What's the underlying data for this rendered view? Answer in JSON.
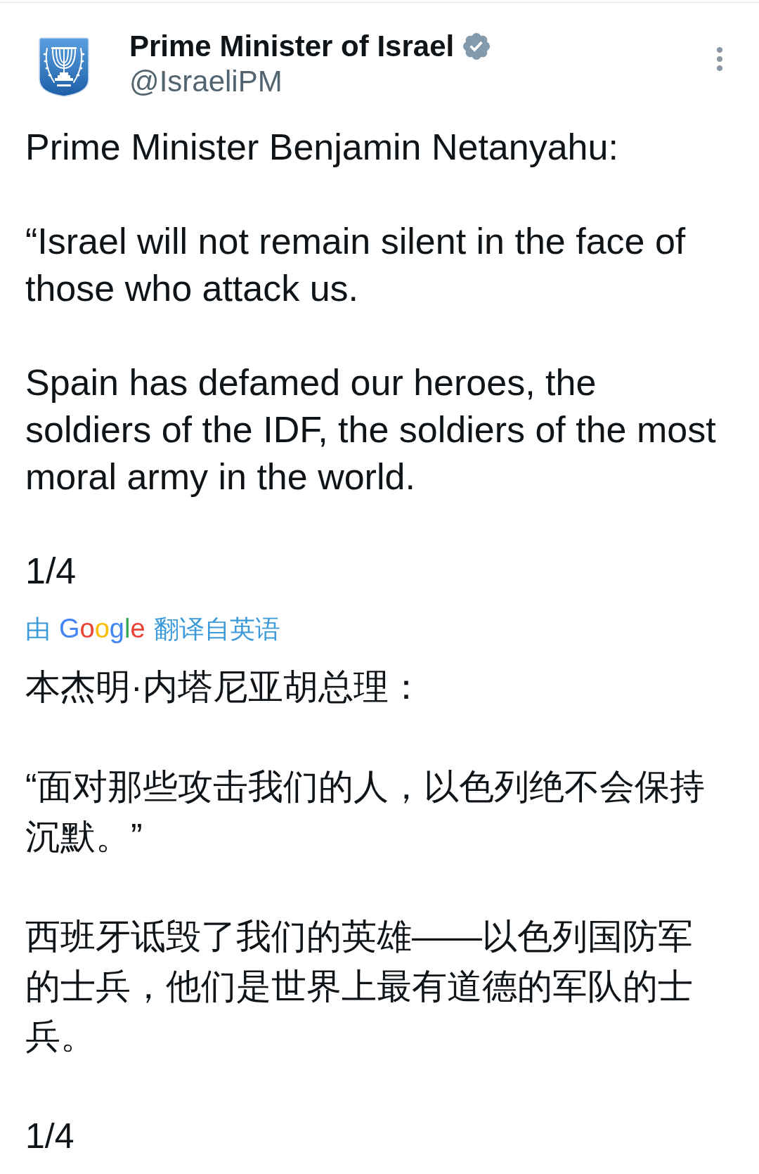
{
  "tweet": {
    "author": {
      "name": "Prime Minister of Israel",
      "handle": "@IsraeliPM",
      "verified": true
    },
    "text": {
      "paragraphs": [
        "Prime Minister Benjamin Netanyahu:",
        "“Israel will not remain silent in the face of\nthose who attack us.",
        "Spain has defamed our heroes, the\nsoldiers of the IDF, the soldiers of the most\nmoral army in the world.",
        "1/4"
      ]
    },
    "translation": {
      "prefix": "由",
      "provider": "Google",
      "suffix": "翻译自英语"
    },
    "translated_text": {
      "paragraphs": [
        "本杰明·内塔尼亚胡总理：",
        "“面对那些攻击我们的人，以色列绝不会保持沉默。”",
        "西班牙诋毁了我们的英雄——以色列国防军的士兵，他们是世界上最有道德的军队的士兵。",
        "1/4"
      ]
    }
  }
}
